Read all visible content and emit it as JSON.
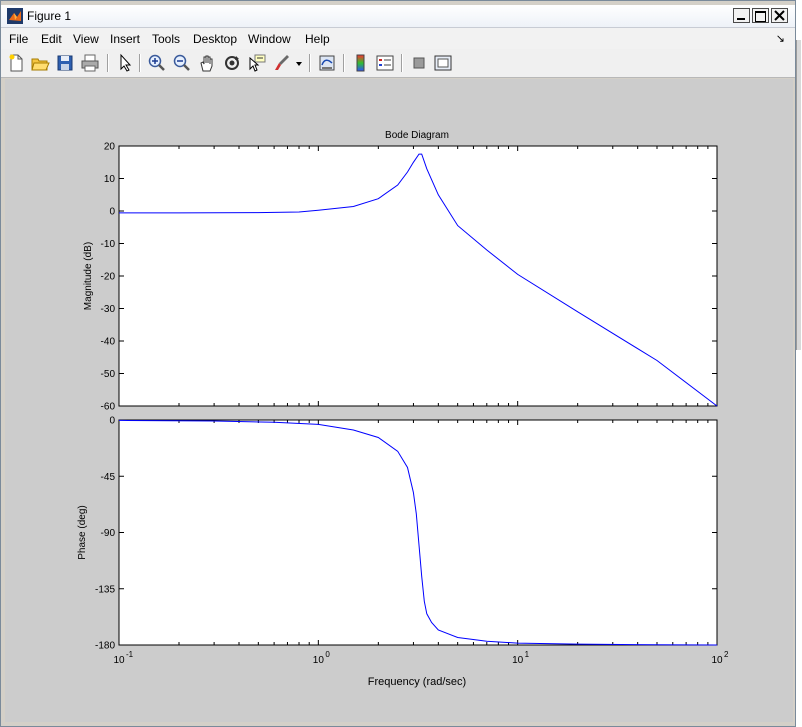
{
  "window": {
    "title": "Figure 1"
  },
  "menu": [
    "File",
    "Edit",
    "View",
    "Insert",
    "Tools",
    "Desktop",
    "Window",
    "Help"
  ],
  "toolbar": {
    "icons": [
      "new-figure-icon",
      "open-file-icon",
      "save-icon",
      "print-icon",
      "pointer-icon",
      "zoom-in-icon",
      "zoom-out-icon",
      "pan-icon",
      "rotate-3d-icon",
      "data-cursor-icon",
      "brush-icon",
      "brush-dropdown-icon",
      "link-plot-icon",
      "colorbar-icon",
      "legend-icon",
      "hide-plot-tools-icon",
      "show-plot-tools-icon"
    ]
  },
  "chart_data": {
    "type": "line",
    "title": "Bode Diagram",
    "xlabel": "Frequency  (rad/sec)",
    "xscale": "log",
    "xlim": [
      0.1,
      100
    ],
    "x_tick_labels": [
      "10",
      "10",
      "10",
      "10"
    ],
    "x_tick_exponents": [
      "-1",
      "0",
      "1",
      "2"
    ],
    "series_color": "#0000ff",
    "panels": [
      {
        "name": "magnitude",
        "ylabel": "Magnitude (dB)",
        "ylim": [
          -60,
          20
        ],
        "y_ticks": [
          20,
          10,
          0,
          -10,
          -20,
          -30,
          -40,
          -50,
          -60
        ],
        "x": [
          0.1,
          0.2,
          0.5,
          0.8,
          1.0,
          1.5,
          2.0,
          2.5,
          2.8,
          3.0,
          3.2,
          3.3,
          3.5,
          4.0,
          5.0,
          7.0,
          10,
          20,
          50,
          100
        ],
        "y": [
          -0.6,
          -0.6,
          -0.5,
          -0.3,
          0.2,
          1.4,
          3.8,
          8.0,
          12.0,
          15.0,
          17.5,
          17.5,
          13.0,
          5.0,
          -4.5,
          -12.0,
          -19.5,
          -31.0,
          -46.0,
          -60.0
        ]
      },
      {
        "name": "phase",
        "ylabel": "Phase (deg)",
        "ylim": [
          -180,
          0
        ],
        "y_ticks": [
          0,
          -45,
          -90,
          -135,
          -180
        ],
        "x": [
          0.1,
          0.3,
          0.6,
          1.0,
          1.5,
          2.0,
          2.5,
          2.8,
          3.0,
          3.1,
          3.2,
          3.3,
          3.4,
          3.5,
          3.7,
          4.0,
          5.0,
          7.0,
          10,
          20,
          50,
          100
        ],
        "y": [
          -0.3,
          -0.8,
          -1.8,
          -3.5,
          -8,
          -14,
          -25,
          -38,
          -58,
          -75,
          -100,
          -125,
          -145,
          -155,
          -162,
          -168,
          -174,
          -177,
          -178.5,
          -179.3,
          -179.8,
          -180
        ]
      }
    ]
  }
}
